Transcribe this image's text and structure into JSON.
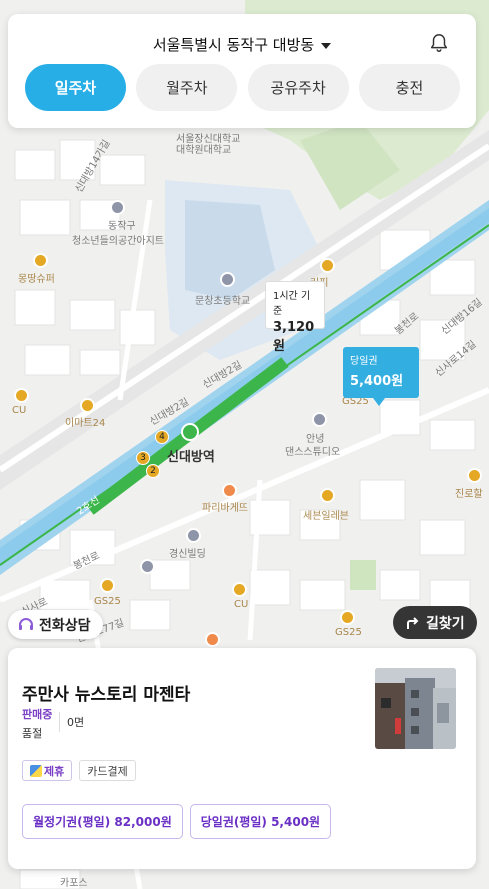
{
  "header": {
    "location": "서울특별시 동작구 대방동",
    "tabs": [
      {
        "label": "일주차",
        "active": true
      },
      {
        "label": "월주차",
        "active": false
      },
      {
        "label": "공유주차",
        "active": false
      },
      {
        "label": "충전",
        "active": false
      }
    ],
    "bell_icon": "bell-icon"
  },
  "map": {
    "labels": {
      "univ": "서울장신대학교",
      "univ_sub": "대학원대학교",
      "school": "문창초등학교",
      "youth_center": "동작구",
      "youth_center_sub": "청소년들의공간아지트",
      "store_mongttang": "몽땅슈퍼",
      "cu_left": "CU",
      "emart24": "이마트24",
      "station": "신대방역",
      "paris": "파리바게뜨",
      "kyungsin": "경신빌딩",
      "seven": "세븐일레븐",
      "studio": "안녕",
      "studio_sub": "댄스스튜디오",
      "gs25_top": "GS25",
      "gs25_left": "GS25",
      "gs25_bottom": "GS25",
      "cu_bottom": "CU",
      "coffee": "커피",
      "road_2ho": "2호선",
      "road_a": "신대방14가길",
      "road_b": "신대방2길",
      "road_c": "신대방16길",
      "road_d": "신사로14길",
      "road_e": "난곡로77길",
      "road_f": "신대방2길",
      "road_g": "봉천로",
      "road_h": "봉천로",
      "road_i": "신사로",
      "road_j": "진로할",
      "bottom_edge": "카포스",
      "line_numbers": [
        "4",
        "3",
        "2"
      ]
    }
  },
  "price_tags": {
    "hourly": {
      "label": "1시간 기준",
      "price": "3,120원"
    },
    "daily": {
      "label": "당일권",
      "price": "5,400원"
    }
  },
  "buttons": {
    "call": "전화상담",
    "route": "길찾기"
  },
  "card": {
    "name": "주만사 뉴스토리 마젠타",
    "status_onsale": "판매중",
    "status_soldout": "품절",
    "surface_count": "0면",
    "chips": [
      "제휴",
      "카드결제"
    ],
    "tickets": [
      "월정기권(평일) 82,000원",
      "당일권(평일) 5,400원"
    ]
  },
  "colors": {
    "accent": "#27aee6",
    "purple": "#7a3fc4",
    "subway_green": "#3cb64a",
    "river": "#8fd0f0"
  }
}
